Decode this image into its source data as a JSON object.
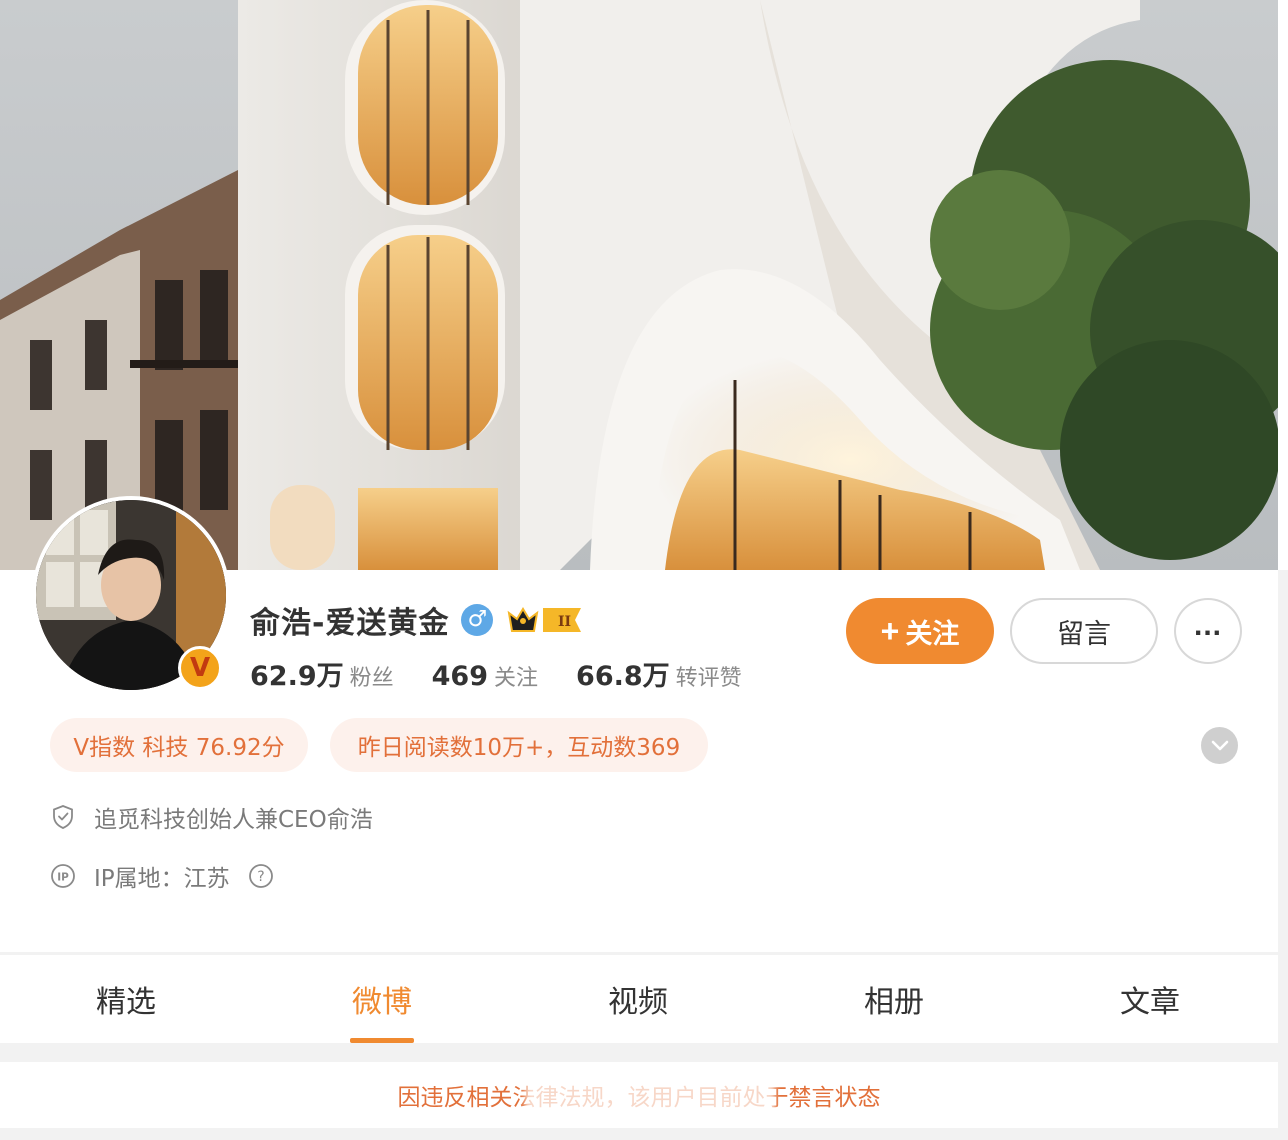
{
  "profile": {
    "name": "俞浩-爱送黄金",
    "gender_symbol": "♂",
    "member_level": "II",
    "verified_badge": "V",
    "stats": [
      {
        "value": "62.9万",
        "label": "粉丝"
      },
      {
        "value": "469",
        "label": "关注"
      },
      {
        "value": "66.8万",
        "label": "转评赞"
      }
    ],
    "tags": [
      "V指数 科技 76.92分",
      "昨日阅读数10万+，互动数369"
    ],
    "verification": "追觅科技创始人兼CEO俞浩",
    "ip_location": "IP属地：江苏"
  },
  "actions": {
    "follow_plus": "+",
    "follow_label": "关注",
    "message_label": "留言",
    "more_label": "..."
  },
  "tabs": [
    {
      "label": "精选",
      "active": false
    },
    {
      "label": "微博",
      "active": true
    },
    {
      "label": "视频",
      "active": false
    },
    {
      "label": "相册",
      "active": false
    },
    {
      "label": "文章",
      "active": false
    }
  ],
  "notice": "因违反相关法律法规，该用户目前处于禁言状态",
  "colors": {
    "accent": "#f08a30",
    "tag_text": "#e2703a",
    "tag_bg": "#fdf1ec",
    "gender_blue": "#5ea8e6",
    "badge_gold": "#f3a31a"
  },
  "icons": {
    "verification": "shield-check-icon",
    "ip": "ip-icon",
    "help": "question-circle-icon",
    "expand": "chevron-down-icon"
  }
}
